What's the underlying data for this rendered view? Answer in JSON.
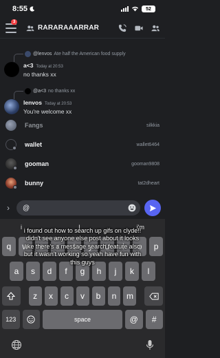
{
  "status_bar": {
    "time": "8:55",
    "battery": "52"
  },
  "header": {
    "badge": "3",
    "channel_name": "RARARAAARRAR"
  },
  "messages": [
    {
      "reply_user": "@lenvos",
      "reply_text": "Ate half the American food supply",
      "user": "a<3",
      "time": "Today at 20:53",
      "text": "no thanks xx"
    },
    {
      "reply_user": "@a<3",
      "reply_text": "no thanks xx",
      "user": "lenvos",
      "time": "Today at 20:53",
      "text": "You're welcome xx"
    }
  ],
  "suggestions": [
    {
      "name": "Fangs",
      "handle": "silkkia"
    },
    {
      "name": "wallet",
      "handle": "wallet6464"
    },
    {
      "name": "gooman",
      "handle": "gooman9808"
    },
    {
      "name": "bunny",
      "handle": "tat2dheart"
    }
  ],
  "composer": {
    "value": "@"
  },
  "keyboard": {
    "predictions": [
      "i",
      "I",
      "i'm"
    ],
    "row1": [
      "q",
      "w",
      "e",
      "r",
      "t",
      "y",
      "u",
      "i",
      "o",
      "p"
    ],
    "row2": [
      "a",
      "s",
      "d",
      "f",
      "g",
      "h",
      "j",
      "k",
      "l"
    ],
    "row3": [
      "z",
      "x",
      "c",
      "v",
      "b",
      "n",
      "m"
    ],
    "numbers_key": "123",
    "space_key": "space",
    "at_key": "@",
    "hash_key": "#"
  },
  "overlay_caption": "i found out how to search up gifs on clyde!! didn't see anyone else post about it looks like there's a message search feature also but it wasn't working so yeah have fun with this guys",
  "colors": {
    "accent": "#5865f2",
    "badge": "#f23f43",
    "background": "#1e1f22"
  }
}
